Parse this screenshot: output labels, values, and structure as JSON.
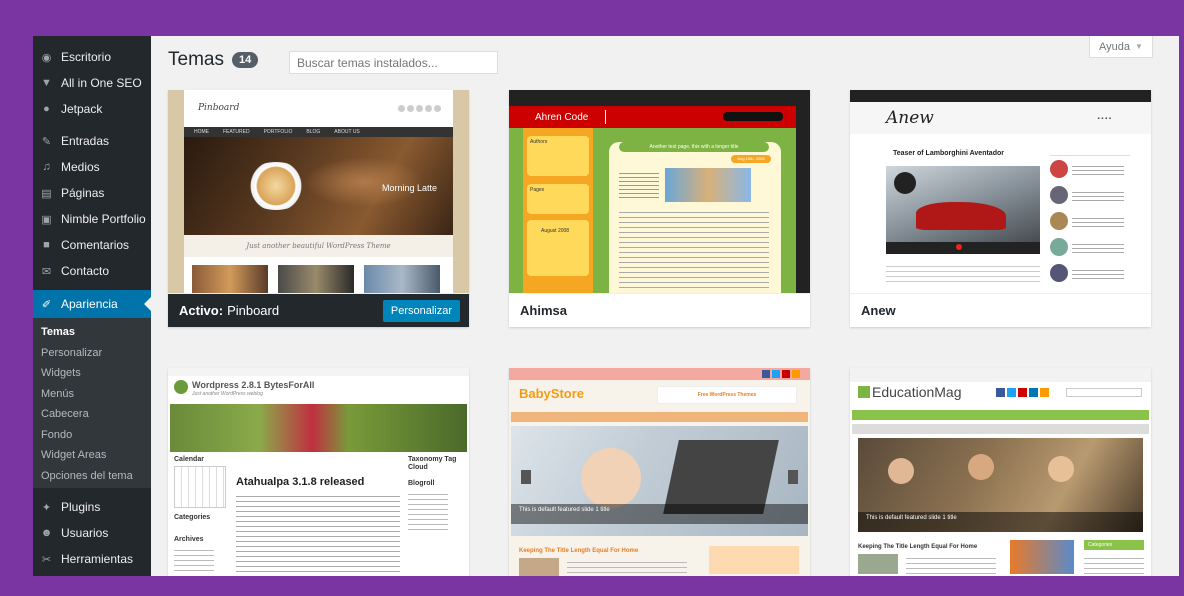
{
  "sidebar": {
    "items_top": [
      {
        "label": "Escritorio",
        "icon": "dashboard-icon"
      },
      {
        "label": "All in One SEO",
        "icon": "seo-icon"
      },
      {
        "label": "Jetpack",
        "icon": "jetpack-icon"
      }
    ],
    "items_mid": [
      {
        "label": "Entradas",
        "icon": "pin-icon"
      },
      {
        "label": "Medios",
        "icon": "media-icon"
      },
      {
        "label": "Páginas",
        "icon": "pages-icon"
      },
      {
        "label": "Nimble Portfolio",
        "icon": "portfolio-icon"
      },
      {
        "label": "Comentarios",
        "icon": "comments-icon"
      },
      {
        "label": "Contacto",
        "icon": "mail-icon"
      }
    ],
    "current": {
      "label": "Apariencia",
      "icon": "appearance-icon"
    },
    "submenu": [
      "Temas",
      "Personalizar",
      "Widgets",
      "Menús",
      "Cabecera",
      "Fondo",
      "Widget Areas",
      "Opciones del tema"
    ],
    "items_bottom": [
      {
        "label": "Plugins",
        "icon": "plugins-icon"
      },
      {
        "label": "Usuarios",
        "icon": "users-icon"
      },
      {
        "label": "Herramientas",
        "icon": "tools-icon"
      }
    ]
  },
  "header": {
    "title": "Temas",
    "count": "14",
    "search_placeholder": "Buscar temas instalados...",
    "help": "Ayuda"
  },
  "themes": [
    {
      "name": "Pinboard",
      "active_label": "Activo:",
      "customize_label": "Personalizar",
      "shot": {
        "logo": "Pinboard",
        "nav": [
          "HOME",
          "FEATURED",
          "PORTFOLIO",
          "BLOG",
          "ABOUT US"
        ],
        "slide_caption": "Morning Latte",
        "tagline": "Just another beautiful WordPress Theme"
      }
    },
    {
      "name": "Ahimsa",
      "shot": {
        "logo": "Ahren Code",
        "post_title": "Another test page, this with a longer title",
        "date": "Aug 10th, 2008",
        "calendar_month": "August 2008",
        "side_labels": [
          "Authors",
          "Pages"
        ]
      }
    },
    {
      "name": "Anew",
      "shot": {
        "logo": "Anew",
        "post_title": "Teaser of Lamborghini Aventador"
      }
    },
    {
      "name": "",
      "shot": {
        "logo": "Wordpress 2.8.1 BytesForAll",
        "tagline": "Just another WordPress weblog",
        "post_title": "Atahualpa 3.1.8 released",
        "side_title": "Taxonomy Tag Cloud",
        "blogroll": "Blogroll",
        "calendar": "Calendar",
        "categories": "Categories",
        "archives": "Archives"
      }
    },
    {
      "name": "",
      "shot": {
        "logo": "BabyStore",
        "banner": "Free WordPress Themes",
        "slide_title": "This is default featured slide 1 title",
        "post_title": "Keeping The Title Length Equal For Home"
      }
    },
    {
      "name": "",
      "shot": {
        "logo": "EducationMag",
        "slide_title": "This is default featured slide 1 title",
        "post_title": "Keeping The Title Length Equal For Home",
        "side_title": "Categories"
      }
    }
  ]
}
